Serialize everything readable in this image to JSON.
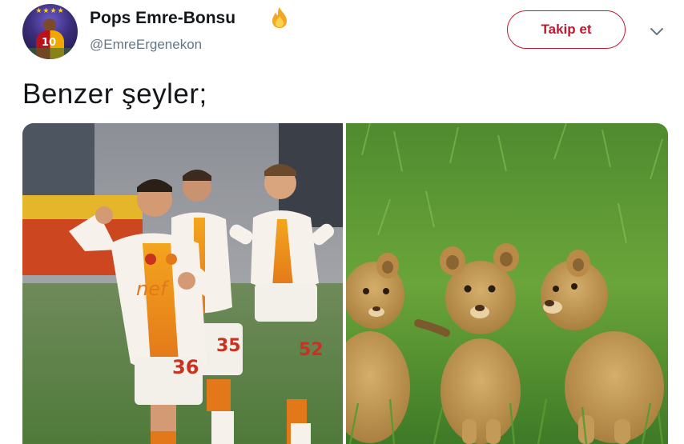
{
  "tweet": {
    "author_name": "Pops Emre-Bonsu",
    "author_handle": "@EmreErgenekon",
    "name_emoji": "fire-icon",
    "text": "Benzer şeyler;",
    "avatar_number": "10",
    "jersey_numbers": [
      "36",
      "35",
      "52"
    ]
  },
  "actions": {
    "follow_label": "Takip et",
    "more_icon": "chevron-down-icon"
  },
  "media": [
    {
      "name": "football-players-photo"
    },
    {
      "name": "lion-cubs-photo"
    }
  ],
  "colors": {
    "follow_accent": "#c5162e",
    "handle_gray": "#657786",
    "text": "#14171a",
    "fire": "#f5a623"
  }
}
